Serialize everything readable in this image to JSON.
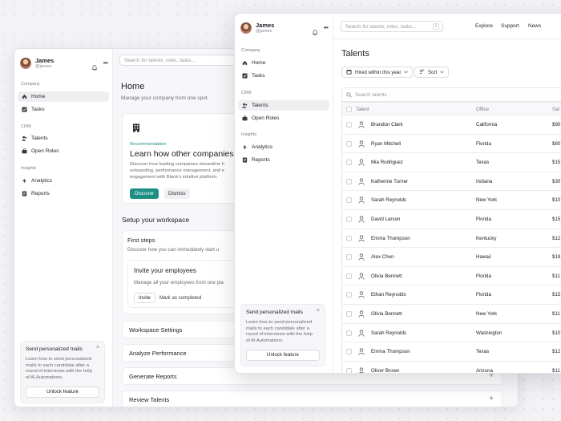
{
  "user": {
    "name": "James",
    "handle": "@james"
  },
  "nav": {
    "company_label": "Company",
    "crm_label": "CRM",
    "insights_label": "Insights",
    "home": "Home",
    "tasks": "Tasks",
    "talents": "Talents",
    "open_roles": "Open Roles",
    "analytics": "Analytics",
    "reports": "Reports"
  },
  "promo": {
    "title": "Send personalized mails",
    "desc_lines": [
      "Learn how to send personalized",
      "mails to each candidate after a",
      "round of interviews with the help",
      "of AI Automations."
    ],
    "button": "Unlock feature",
    "close": "×"
  },
  "search_placeholder": "Search for talents, roles, tasks...",
  "home": {
    "title": "Home",
    "subtitle": "Manage your company from one spot.",
    "rec_label": "Recommendation",
    "rec_title": "Learn how other companies",
    "rec_desc_lines": [
      "Discover how leading companies streamline h",
      "onboarding, performance management, and e",
      "engagement with Blank's intuitive platform."
    ],
    "discover": "Discover",
    "dismiss": "Dismiss",
    "setup_title": "Setup your workspace",
    "first_steps": "First steps",
    "first_steps_sub": "Discover how you can immediately start u",
    "invite_title": "Invite your employees",
    "invite_sub": "Manage all your employees from one pla",
    "invite_btn": "Invite",
    "mark_completed": "Mark as completed",
    "accordions": [
      "Workspace Settings",
      "Analyze Performance",
      "Generate Reports",
      "Review Talents"
    ]
  },
  "topbar": {
    "kbd": "/",
    "links": [
      "Explore",
      "Support",
      "News"
    ]
  },
  "talents": {
    "title": "Talents",
    "filter_hired": "Hired within this year",
    "sort": "Sort",
    "search_placeholder": "Search talents",
    "columns": [
      "Talent",
      "Office",
      "Sal"
    ],
    "rows": [
      {
        "name": "Brandon Clark",
        "office": "California",
        "salary": "$90"
      },
      {
        "name": "Ryan Mitchell",
        "office": "Florida",
        "salary": "$80"
      },
      {
        "name": "Mia Rodriguez",
        "office": "Texas",
        "salary": "$15"
      },
      {
        "name": "Katherine Turner",
        "office": "Indiana",
        "salary": "$30"
      },
      {
        "name": "Sarah Reynolds",
        "office": "New York",
        "salary": "$10"
      },
      {
        "name": "David Larson",
        "office": "Florida",
        "salary": "$15"
      },
      {
        "name": "Emma Thompson",
        "office": "Kentucky",
        "salary": "$12"
      },
      {
        "name": "Alex Chen",
        "office": "Hawaii",
        "salary": "$19"
      },
      {
        "name": "Olivia Bennett",
        "office": "Florida",
        "salary": "$11"
      },
      {
        "name": "Ethan Reynolds",
        "office": "Florida",
        "salary": "$15"
      },
      {
        "name": "Olivia Bennett",
        "office": "New York",
        "salary": "$11"
      },
      {
        "name": "Sarah Reynolds",
        "office": "Washington",
        "salary": "$10"
      },
      {
        "name": "Emma Thompson",
        "office": "Texas",
        "salary": "$12"
      },
      {
        "name": "Oliver Brown",
        "office": "Arizona",
        "salary": "$11"
      }
    ]
  },
  "colors": {
    "accent": "#1f8f86",
    "background": "#f3f3f6"
  }
}
